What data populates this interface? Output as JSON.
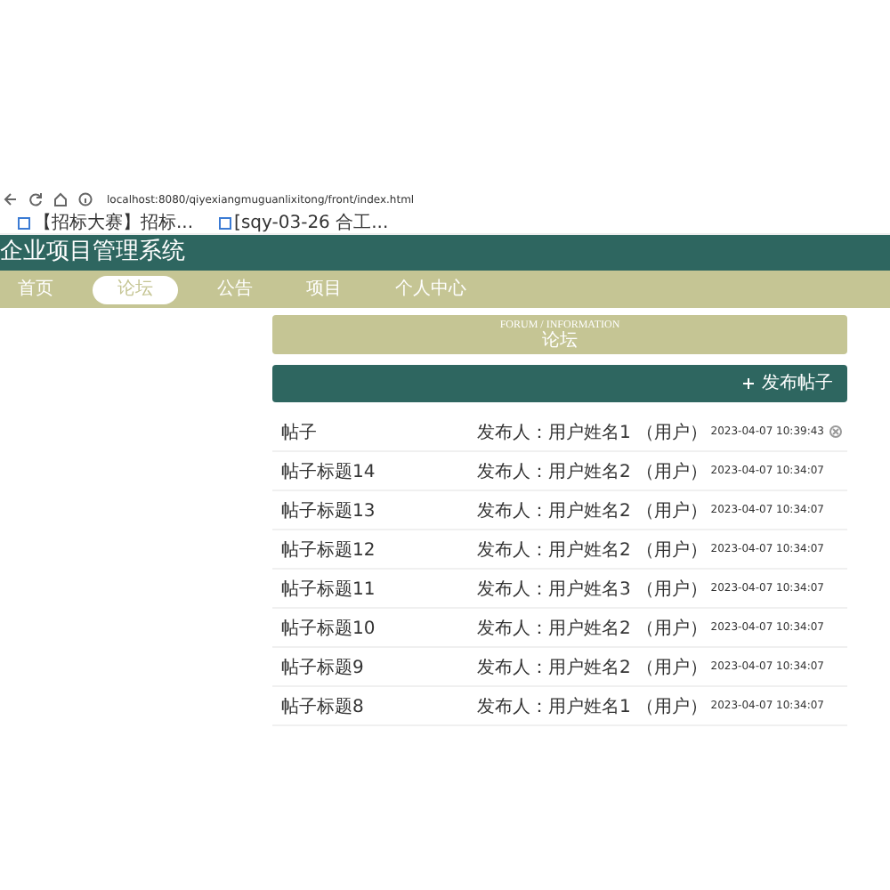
{
  "browser": {
    "url": "localhost:8080/qiyexiangmuguanlixitong/front/index.html",
    "bookmarks": [
      "【招标大赛】招标...",
      "[sqy-03-26 合工..."
    ]
  },
  "header": {
    "title": "企业项目管理系统"
  },
  "nav": [
    {
      "label": "首页",
      "selected": false
    },
    {
      "label": "论坛",
      "selected": true
    },
    {
      "label": "公告",
      "selected": false
    },
    {
      "label": "项目",
      "selected": false
    },
    {
      "label": "个人中心",
      "selected": false
    }
  ],
  "banner": {
    "title": "FORUM / INFORMATION",
    "subtitle": "论坛"
  },
  "toolbar": {
    "add_button": "发布帖子"
  },
  "posts": [
    {
      "title": "帖子",
      "poster": "发布人：用户姓名1 （用户）",
      "time": "2023-04-07 10:39:43",
      "deletable": true
    },
    {
      "title": "帖子标题14",
      "poster": "发布人：用户姓名2 （用户）",
      "time": "2023-04-07 10:34:07",
      "deletable": false
    },
    {
      "title": "帖子标题13",
      "poster": "发布人：用户姓名2 （用户）",
      "time": "2023-04-07 10:34:07",
      "deletable": false
    },
    {
      "title": "帖子标题12",
      "poster": "发布人：用户姓名2 （用户）",
      "time": "2023-04-07 10:34:07",
      "deletable": false
    },
    {
      "title": "帖子标题11",
      "poster": "发布人：用户姓名3 （用户）",
      "time": "2023-04-07 10:34:07",
      "deletable": false
    },
    {
      "title": "帖子标题10",
      "poster": "发布人：用户姓名2 （用户）",
      "time": "2023-04-07 10:34:07",
      "deletable": false
    },
    {
      "title": "帖子标题9",
      "poster": "发布人：用户姓名2 （用户）",
      "time": "2023-04-07 10:34:07",
      "deletable": false
    },
    {
      "title": "帖子标题8",
      "poster": "发布人：用户姓名1 （用户）",
      "time": "2023-04-07 10:34:07",
      "deletable": false
    }
  ]
}
